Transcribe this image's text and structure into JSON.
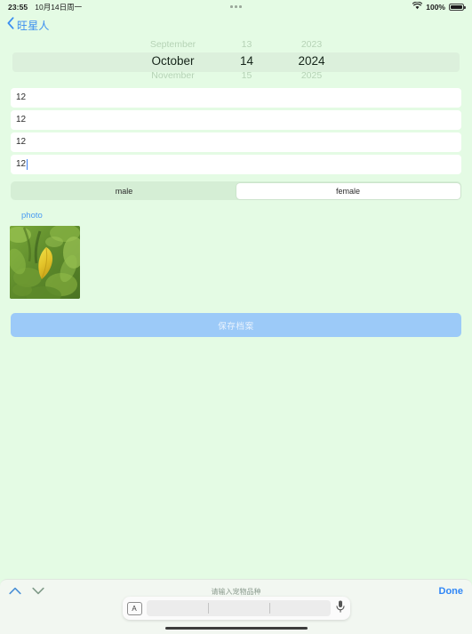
{
  "status_bar": {
    "time": "23:55",
    "date": "10月14日周一",
    "battery_percent": "100%",
    "wifi_icon": "wifi-icon",
    "multitask_icon": "more-dots-icon"
  },
  "nav": {
    "back_icon": "chevron-left-icon",
    "back_label": "旺星人"
  },
  "date_picker": {
    "rows": {
      "above": {
        "month": "September",
        "day": "13",
        "year": "2023"
      },
      "selected": {
        "month": "October",
        "day": "14",
        "year": "2024"
      },
      "below": {
        "month": "November",
        "day": "15",
        "year": "2025"
      }
    }
  },
  "fields": [
    {
      "value": "12",
      "placeholder": "请输入宠物品种",
      "focused": false
    },
    {
      "value": "12",
      "placeholder": "请输入宠物品种",
      "focused": false
    },
    {
      "value": "12",
      "placeholder": "请输入宠物品种",
      "focused": false
    },
    {
      "value": "12",
      "placeholder": "请输入宠物品种",
      "focused": true
    }
  ],
  "gender": {
    "options": [
      "male",
      "female"
    ],
    "selected": "female"
  },
  "photo": {
    "label": "photo",
    "thumbnail_alt": "yellow-leaf-among-green-foliage"
  },
  "save_button": {
    "label": "保存档案"
  },
  "keyboard": {
    "prev_icon": "chevron-up-icon",
    "next_icon": "chevron-down-icon",
    "hint": "请输入宠物品种",
    "done_label": "Done",
    "language_icon": "keyboard-language-icon",
    "language_glyph": "A",
    "mic_icon": "microphone-icon",
    "suggestions": [
      "",
      "",
      ""
    ]
  },
  "colors": {
    "background": "#e4fbe4",
    "accent_blue": "#3b8ef0",
    "save_button": "#9ccaf8",
    "picker_band": "#dcf0dc",
    "segment_track": "#d5eed5"
  }
}
